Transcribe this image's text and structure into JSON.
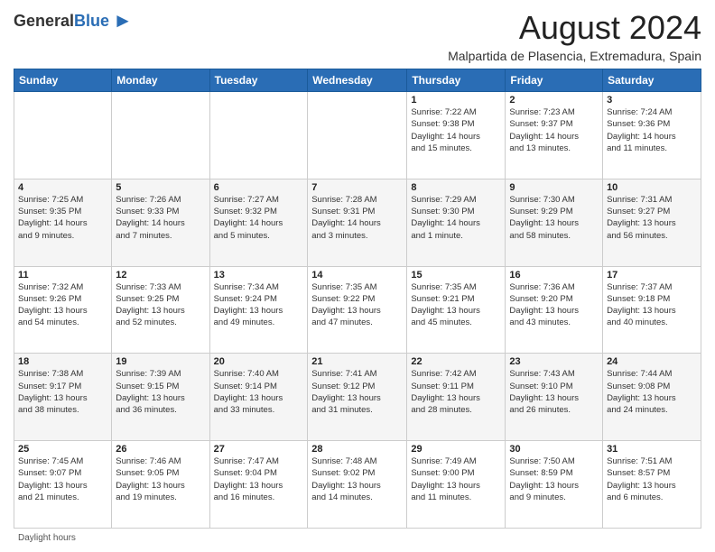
{
  "header": {
    "logo_general": "General",
    "logo_blue": "Blue",
    "month_title": "August 2024",
    "subtitle": "Malpartida de Plasencia, Extremadura, Spain"
  },
  "days_of_week": [
    "Sunday",
    "Monday",
    "Tuesday",
    "Wednesday",
    "Thursday",
    "Friday",
    "Saturday"
  ],
  "weeks": [
    [
      {
        "day": "",
        "info": ""
      },
      {
        "day": "",
        "info": ""
      },
      {
        "day": "",
        "info": ""
      },
      {
        "day": "",
        "info": ""
      },
      {
        "day": "1",
        "info": "Sunrise: 7:22 AM\nSunset: 9:38 PM\nDaylight: 14 hours\nand 15 minutes."
      },
      {
        "day": "2",
        "info": "Sunrise: 7:23 AM\nSunset: 9:37 PM\nDaylight: 14 hours\nand 13 minutes."
      },
      {
        "day": "3",
        "info": "Sunrise: 7:24 AM\nSunset: 9:36 PM\nDaylight: 14 hours\nand 11 minutes."
      }
    ],
    [
      {
        "day": "4",
        "info": "Sunrise: 7:25 AM\nSunset: 9:35 PM\nDaylight: 14 hours\nand 9 minutes."
      },
      {
        "day": "5",
        "info": "Sunrise: 7:26 AM\nSunset: 9:33 PM\nDaylight: 14 hours\nand 7 minutes."
      },
      {
        "day": "6",
        "info": "Sunrise: 7:27 AM\nSunset: 9:32 PM\nDaylight: 14 hours\nand 5 minutes."
      },
      {
        "day": "7",
        "info": "Sunrise: 7:28 AM\nSunset: 9:31 PM\nDaylight: 14 hours\nand 3 minutes."
      },
      {
        "day": "8",
        "info": "Sunrise: 7:29 AM\nSunset: 9:30 PM\nDaylight: 14 hours\nand 1 minute."
      },
      {
        "day": "9",
        "info": "Sunrise: 7:30 AM\nSunset: 9:29 PM\nDaylight: 13 hours\nand 58 minutes."
      },
      {
        "day": "10",
        "info": "Sunrise: 7:31 AM\nSunset: 9:27 PM\nDaylight: 13 hours\nand 56 minutes."
      }
    ],
    [
      {
        "day": "11",
        "info": "Sunrise: 7:32 AM\nSunset: 9:26 PM\nDaylight: 13 hours\nand 54 minutes."
      },
      {
        "day": "12",
        "info": "Sunrise: 7:33 AM\nSunset: 9:25 PM\nDaylight: 13 hours\nand 52 minutes."
      },
      {
        "day": "13",
        "info": "Sunrise: 7:34 AM\nSunset: 9:24 PM\nDaylight: 13 hours\nand 49 minutes."
      },
      {
        "day": "14",
        "info": "Sunrise: 7:35 AM\nSunset: 9:22 PM\nDaylight: 13 hours\nand 47 minutes."
      },
      {
        "day": "15",
        "info": "Sunrise: 7:35 AM\nSunset: 9:21 PM\nDaylight: 13 hours\nand 45 minutes."
      },
      {
        "day": "16",
        "info": "Sunrise: 7:36 AM\nSunset: 9:20 PM\nDaylight: 13 hours\nand 43 minutes."
      },
      {
        "day": "17",
        "info": "Sunrise: 7:37 AM\nSunset: 9:18 PM\nDaylight: 13 hours\nand 40 minutes."
      }
    ],
    [
      {
        "day": "18",
        "info": "Sunrise: 7:38 AM\nSunset: 9:17 PM\nDaylight: 13 hours\nand 38 minutes."
      },
      {
        "day": "19",
        "info": "Sunrise: 7:39 AM\nSunset: 9:15 PM\nDaylight: 13 hours\nand 36 minutes."
      },
      {
        "day": "20",
        "info": "Sunrise: 7:40 AM\nSunset: 9:14 PM\nDaylight: 13 hours\nand 33 minutes."
      },
      {
        "day": "21",
        "info": "Sunrise: 7:41 AM\nSunset: 9:12 PM\nDaylight: 13 hours\nand 31 minutes."
      },
      {
        "day": "22",
        "info": "Sunrise: 7:42 AM\nSunset: 9:11 PM\nDaylight: 13 hours\nand 28 minutes."
      },
      {
        "day": "23",
        "info": "Sunrise: 7:43 AM\nSunset: 9:10 PM\nDaylight: 13 hours\nand 26 minutes."
      },
      {
        "day": "24",
        "info": "Sunrise: 7:44 AM\nSunset: 9:08 PM\nDaylight: 13 hours\nand 24 minutes."
      }
    ],
    [
      {
        "day": "25",
        "info": "Sunrise: 7:45 AM\nSunset: 9:07 PM\nDaylight: 13 hours\nand 21 minutes."
      },
      {
        "day": "26",
        "info": "Sunrise: 7:46 AM\nSunset: 9:05 PM\nDaylight: 13 hours\nand 19 minutes."
      },
      {
        "day": "27",
        "info": "Sunrise: 7:47 AM\nSunset: 9:04 PM\nDaylight: 13 hours\nand 16 minutes."
      },
      {
        "day": "28",
        "info": "Sunrise: 7:48 AM\nSunset: 9:02 PM\nDaylight: 13 hours\nand 14 minutes."
      },
      {
        "day": "29",
        "info": "Sunrise: 7:49 AM\nSunset: 9:00 PM\nDaylight: 13 hours\nand 11 minutes."
      },
      {
        "day": "30",
        "info": "Sunrise: 7:50 AM\nSunset: 8:59 PM\nDaylight: 13 hours\nand 9 minutes."
      },
      {
        "day": "31",
        "info": "Sunrise: 7:51 AM\nSunset: 8:57 PM\nDaylight: 13 hours\nand 6 minutes."
      }
    ]
  ],
  "footer": {
    "daylight_label": "Daylight hours"
  }
}
